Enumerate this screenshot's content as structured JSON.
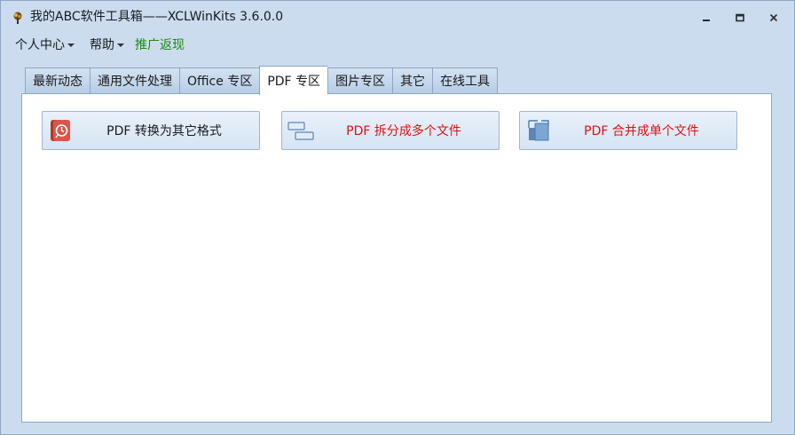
{
  "window": {
    "title": "我的ABC软件工具箱——XCLWinKits  3.6.0.0",
    "controls": {
      "minimize": "minimize-icon",
      "maximize": "maximize-icon",
      "close": "close-icon"
    }
  },
  "menu": {
    "personal": "个人中心",
    "help": "帮助",
    "promo": "推广返现",
    "promo_color": "#1b8a12"
  },
  "tabs": [
    {
      "label": "最新动态"
    },
    {
      "label": "通用文件处理"
    },
    {
      "label": "Office 专区"
    },
    {
      "label": "PDF 专区",
      "active": true
    },
    {
      "label": "图片专区"
    },
    {
      "label": "其它"
    },
    {
      "label": "在线工具"
    }
  ],
  "panel": {
    "buttons": [
      {
        "label": "PDF 转换为其它格式",
        "icon": "pdf-convert-icon",
        "color": "#1a1a1a"
      },
      {
        "label": "PDF 拆分成多个文件",
        "icon": "split-icon",
        "color": "#e0100f"
      },
      {
        "label": "PDF 合并成单个文件",
        "icon": "merge-icon",
        "color": "#e0100f"
      }
    ]
  }
}
